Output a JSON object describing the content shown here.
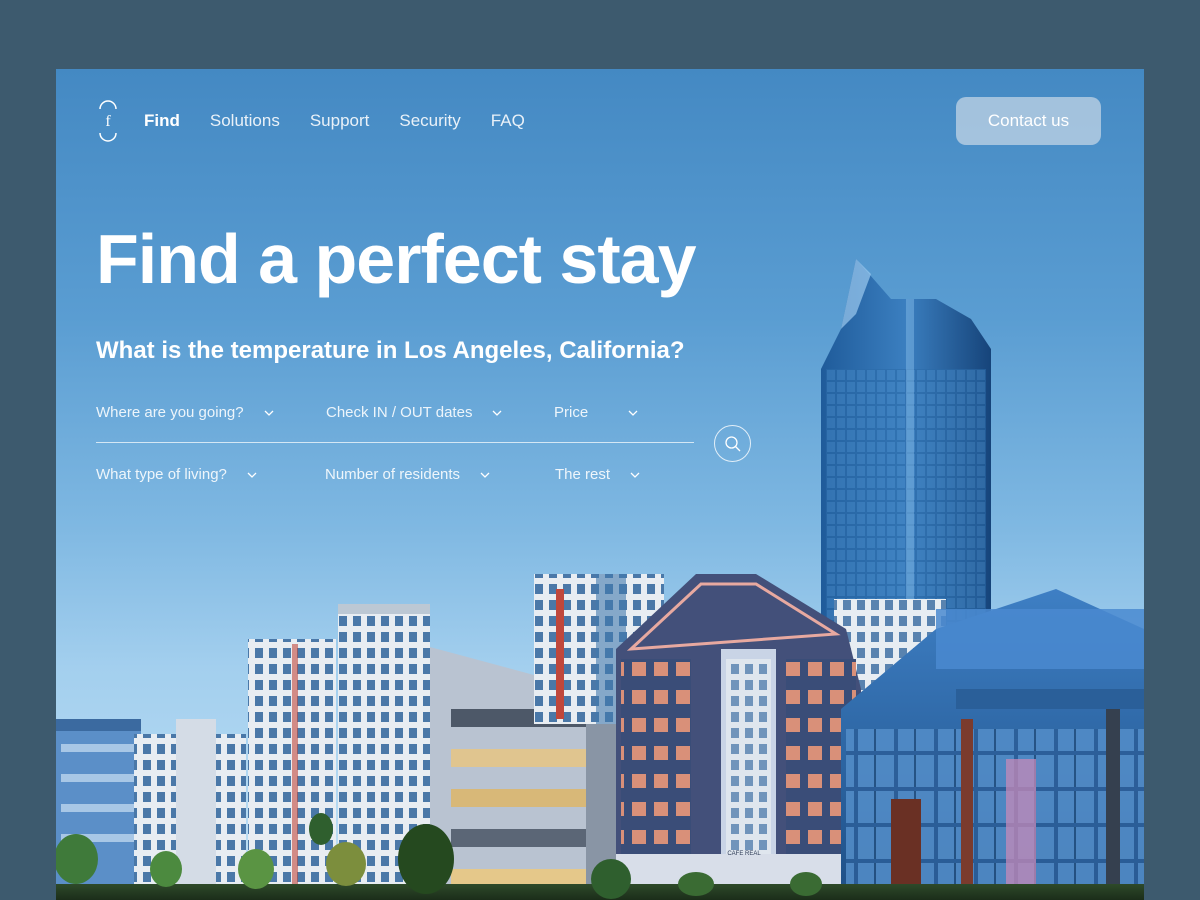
{
  "logo": {
    "letter": "f"
  },
  "nav": {
    "items": [
      {
        "label": "Find",
        "active": true
      },
      {
        "label": "Solutions",
        "active": false
      },
      {
        "label": "Support",
        "active": false
      },
      {
        "label": "Security",
        "active": false
      },
      {
        "label": "FAQ",
        "active": false
      }
    ]
  },
  "header": {
    "contact_label": "Contact us"
  },
  "hero": {
    "title": "Find a perfect stay",
    "subtitle": "What is the temperature in Los Angeles, California?"
  },
  "filters": {
    "row1": [
      "Where are you going?",
      "Check IN / OUT dates",
      "Price"
    ],
    "row2": [
      "What type of living?",
      "Number of residents",
      "The rest"
    ]
  },
  "icons": {
    "filter_chevron": "chevron-down-icon",
    "search": "search-icon"
  },
  "colors": {
    "page_bg": "#3d5a6e",
    "sky_top": "#4489c3",
    "sky_bottom": "#bfe0f5",
    "text": "#ffffff"
  },
  "scene": {
    "storefront_sign": "CAFE REAL"
  }
}
